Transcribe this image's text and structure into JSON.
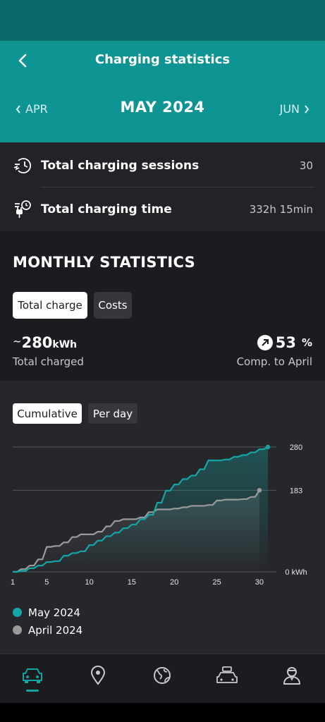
{
  "header": {
    "title": "Charging statistics",
    "prev_month": "APR",
    "current_month": "MAY 2024",
    "next_month": "JUN"
  },
  "summary": {
    "sessions": {
      "label": "Total charging sessions",
      "value": "30",
      "icon": "charging-session-icon"
    },
    "time": {
      "label": "Total charging time",
      "value": "332h 15min",
      "icon": "charging-time-icon"
    }
  },
  "monthly": {
    "title": "MONTHLY STATISTICS",
    "tabs": [
      "Total charge",
      "Costs"
    ],
    "active_tab": "Total charge",
    "total_tilde": "~",
    "total_value": "280",
    "total_unit": "kWh",
    "total_label": "Total charged",
    "compare_value": "53",
    "compare_unit": "%",
    "compare_label": "Comp. to April"
  },
  "chart_toggle": {
    "options": [
      "Cumulative",
      "Per day"
    ],
    "active": "Cumulative"
  },
  "chart_data": {
    "type": "line",
    "x_ticks": [
      "1",
      "5",
      "10",
      "15",
      "20",
      "25",
      "30"
    ],
    "y_ticks": [
      "280",
      "183",
      "0 kWh"
    ],
    "ylim": [
      0,
      280
    ],
    "xlim": [
      1,
      31
    ],
    "series": [
      {
        "name": "May 2024",
        "color": "#14a6a6",
        "x": [
          1,
          2,
          3,
          4,
          5,
          6,
          7,
          8,
          9,
          10,
          11,
          12,
          13,
          14,
          15,
          16,
          17,
          18,
          19,
          20,
          21,
          22,
          23,
          24,
          25,
          26,
          27,
          28,
          29,
          30,
          31
        ],
        "y": [
          0,
          2,
          8,
          14,
          22,
          24,
          36,
          42,
          46,
          60,
          70,
          80,
          88,
          98,
          106,
          118,
          128,
          155,
          182,
          196,
          208,
          216,
          230,
          250,
          250,
          252,
          258,
          262,
          268,
          275,
          280
        ]
      },
      {
        "name": "April 2024",
        "color": "#9a9a9a",
        "x": [
          1,
          2,
          3,
          4,
          5,
          6,
          7,
          8,
          9,
          10,
          11,
          12,
          13,
          14,
          15,
          16,
          17,
          18,
          19,
          20,
          21,
          22,
          23,
          24,
          25,
          26,
          27,
          28,
          29,
          30
        ],
        "y": [
          0,
          6,
          14,
          28,
          56,
          58,
          66,
          78,
          84,
          84,
          90,
          102,
          114,
          118,
          118,
          122,
          134,
          140,
          140,
          142,
          145,
          148,
          148,
          150,
          160,
          162,
          162,
          163,
          168,
          183
        ]
      }
    ]
  },
  "legend": [
    "May 2024",
    "April 2024"
  ],
  "colors": {
    "accent": "#0f9494",
    "may": "#14a6a6",
    "april": "#9a9a9a"
  },
  "bottom_nav": [
    {
      "icon": "car-icon",
      "active": true
    },
    {
      "icon": "location-pin-icon",
      "active": false
    },
    {
      "icon": "globe-icon",
      "active": false
    },
    {
      "icon": "car-service-icon",
      "active": false
    },
    {
      "icon": "profile-icon",
      "active": false
    }
  ]
}
